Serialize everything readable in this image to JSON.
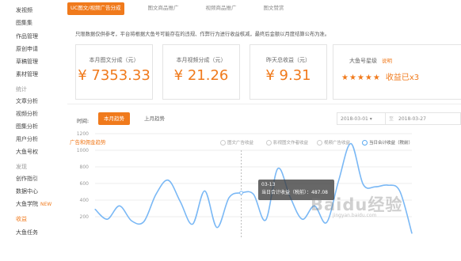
{
  "sidebar": {
    "items": [
      {
        "label": "发视频",
        "type": "item"
      },
      {
        "label": "图集集",
        "type": "item"
      },
      {
        "label": "作品管理",
        "type": "item"
      },
      {
        "label": "原创申请",
        "type": "item"
      },
      {
        "label": "草稿管理",
        "type": "item"
      },
      {
        "label": "素材管理",
        "type": "item"
      },
      {
        "label": "统计",
        "type": "group"
      },
      {
        "label": "文章分析",
        "type": "item"
      },
      {
        "label": "视频分析",
        "type": "item"
      },
      {
        "label": "图集分析",
        "type": "item"
      },
      {
        "label": "用户分析",
        "type": "item"
      },
      {
        "label": "大鱼号权",
        "type": "item"
      },
      {
        "label": "发现",
        "type": "group"
      },
      {
        "label": "创作指引",
        "type": "item"
      },
      {
        "label": "数据中心",
        "type": "item"
      },
      {
        "label": "大鱼学院",
        "type": "item",
        "badge": "NEW"
      },
      {
        "label": "收益",
        "type": "active"
      },
      {
        "label": "大鱼任务",
        "type": "item"
      }
    ]
  },
  "tabs": [
    {
      "label": "UC图文/视频广告分成",
      "active": true
    },
    {
      "label": "图文商品推广",
      "active": false
    },
    {
      "label": "视频商品推广",
      "active": false
    },
    {
      "label": "图文赞赏",
      "active": false
    }
  ],
  "notice": "只限数据仅供参考，平台将根据大鱼号可能存在的违规、作弊行为进行收益核减，最终后金额以月度结算公布为准。",
  "cards": [
    {
      "label": "本月图文分成（元）",
      "value": "¥ 7353.33"
    },
    {
      "label": "本月视频分成（元）",
      "value": "¥ 21.26"
    },
    {
      "label": "昨天总收益（元）",
      "value": "¥ 9.31"
    }
  ],
  "level_card": {
    "label": "大鱼号星级",
    "link": "说明",
    "stars": "★★★★★",
    "stars_value": 5,
    "stars_text": "收益已x3"
  },
  "time_filter": {
    "label": "时间:",
    "buttons": [
      "本月趋势",
      "上月趋势"
    ],
    "date_start": "2018-03-01 ▾",
    "date_end": "2018-03-27",
    "date_sep": "至"
  },
  "chart_title": "广告和佣金趋势",
  "legend": [
    {
      "label": "图文广告收益",
      "active": false
    },
    {
      "label": "影视图文作者收益",
      "active": false
    },
    {
      "label": "视频广告收益",
      "active": false
    },
    {
      "label": "当日合计收益（税前）",
      "active": true
    }
  ],
  "tooltip": {
    "date": "03-13",
    "text": "当日合计收益（税前）：487.08"
  },
  "watermark": {
    "text": "Baidu经验",
    "sub": "jingyan.baidu.com"
  },
  "chart_data": {
    "type": "line",
    "yticks": [
      1200,
      1000,
      800,
      600,
      400,
      200
    ],
    "ylim": [
      0,
      1250
    ],
    "series": [
      {
        "name": "当日合计收益（税前）",
        "color": "#7ab8f5",
        "x": [
          1,
          2,
          3,
          4,
          5,
          6,
          7,
          8,
          9,
          10,
          11,
          12,
          13,
          14,
          15,
          16,
          17,
          18,
          19,
          20,
          21,
          22,
          23,
          24,
          25,
          26,
          27
        ],
        "values": [
          290,
          170,
          330,
          150,
          140,
          470,
          640,
          380,
          110,
          510,
          70,
          430,
          487,
          470,
          160,
          780,
          440,
          170,
          330,
          130,
          640,
          1080,
          590,
          560,
          580,
          510,
          0
        ]
      }
    ]
  }
}
